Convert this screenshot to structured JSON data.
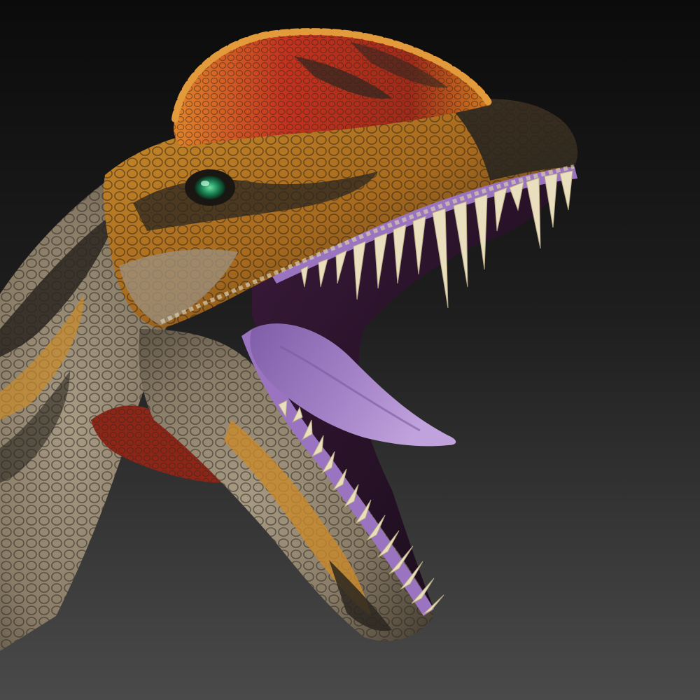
{
  "image": {
    "subject": "dilophosaurus-head-render",
    "colors": {
      "background_top": "#0b0b0b",
      "background_bottom": "#4a4a4a",
      "crest_red": "#c4321e",
      "crest_orange": "#d07a1e",
      "skin_gold": "#c98a2a",
      "skin_dark": "#2a2620",
      "skin_tan": "#9c8f7a",
      "mouth_purple": "#9a74c0",
      "tongue_purple": "#a583c8",
      "tooth_cream": "#e9dfbf",
      "eye_green": "#1f8a5a"
    }
  }
}
